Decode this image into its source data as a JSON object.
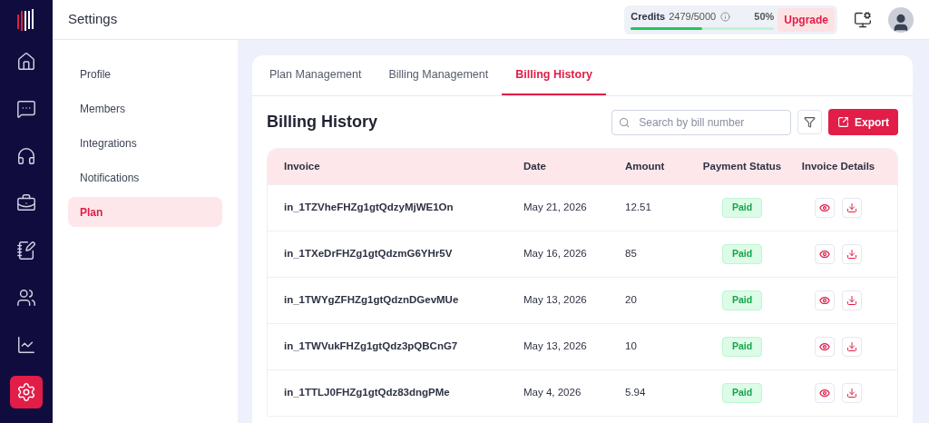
{
  "rail": [
    {
      "kind": "home",
      "selected": false
    },
    {
      "kind": "chat",
      "selected": false
    },
    {
      "kind": "headset",
      "selected": false
    },
    {
      "kind": "briefcase",
      "selected": false
    },
    {
      "kind": "checklist",
      "selected": false
    },
    {
      "kind": "people",
      "selected": false
    },
    {
      "kind": "chart",
      "selected": false
    },
    {
      "kind": "settings",
      "selected": true
    }
  ],
  "header": {
    "title": "Settings",
    "credits": {
      "label": "Credits",
      "value": "2479/5000",
      "percent": "50%",
      "level": 0.5
    },
    "upgrade": "Upgrade"
  },
  "settings_nav": [
    {
      "label": "Profile",
      "selected": false
    },
    {
      "label": "Members",
      "selected": false
    },
    {
      "label": "Integrations",
      "selected": false
    },
    {
      "label": "Notifications",
      "selected": false
    },
    {
      "label": "Plan",
      "selected": true
    }
  ],
  "tabs": [
    {
      "label": "Plan Management",
      "selected": false
    },
    {
      "label": "Billing Management",
      "selected": false
    },
    {
      "label": "Billing History",
      "selected": true
    }
  ],
  "section_title": "Billing History",
  "search": {
    "placeholder": "Search by bill number"
  },
  "export": "Export",
  "table": {
    "columns": [
      "Invoice",
      "Date",
      "Amount",
      "Payment Status",
      "Invoice Details"
    ],
    "rows": [
      {
        "invoice": "in_1TZVheFHZg1gtQdzyMjWE1On",
        "date": "May 21, 2026",
        "amount": "12.51",
        "status": "Paid"
      },
      {
        "invoice": "in_1TXeDrFHZg1gtQdzmG6YHr5V",
        "date": "May 16, 2026",
        "amount": "85",
        "status": "Paid"
      },
      {
        "invoice": "in_1TWYgZFHZg1gtQdznDGevMUe",
        "date": "May 13, 2026",
        "amount": "20",
        "status": "Paid"
      },
      {
        "invoice": "in_1TWVukFHZg1gtQdz3pQBCnG7",
        "date": "May 13, 2026",
        "amount": "10",
        "status": "Paid"
      },
      {
        "invoice": "in_1TTLJ0FHZg1gtQdz83dngPMe",
        "date": "May 4, 2026",
        "amount": "5.94",
        "status": "Paid"
      }
    ]
  }
}
